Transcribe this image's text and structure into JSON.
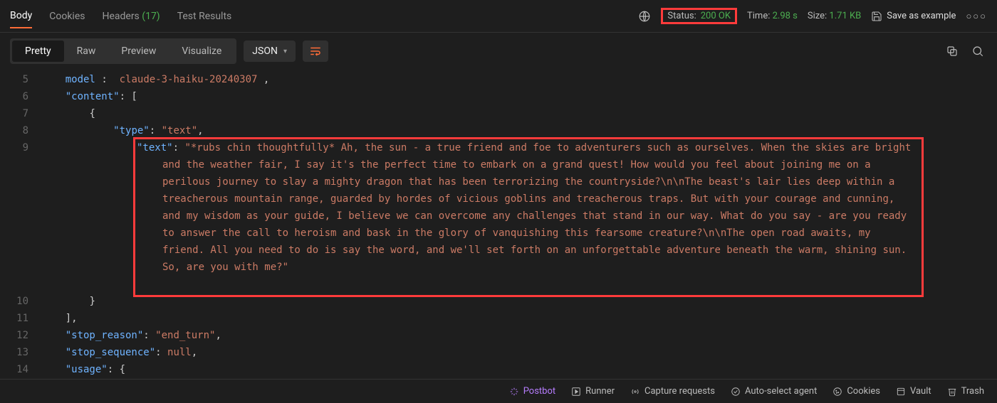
{
  "topTabs": {
    "body": "Body",
    "cookies": "Cookies",
    "headers": "Headers",
    "headersCount": "(17)",
    "testResults": "Test Results"
  },
  "status": {
    "label": "Status:",
    "value": "200 OK",
    "timeLabel": "Time:",
    "timeValue": "2.98 s",
    "sizeLabel": "Size:",
    "sizeValue": "1.71 KB",
    "saveExample": "Save as example"
  },
  "viewTabs": {
    "pretty": "Pretty",
    "raw": "Raw",
    "preview": "Preview",
    "visualize": "Visualize",
    "format": "JSON"
  },
  "response": {
    "line5_key": "model",
    "line5_val": "claude-3-haiku-20240307",
    "line6_key": "\"content\"",
    "line8_key": "\"type\"",
    "line8_val": "\"text\"",
    "line9_key": "\"text\"",
    "line9_val": "\"*rubs chin thoughtfully* Ah, the sun - a true friend and foe to adventurers such as ourselves. When the skies are bright and the weather fair, I say it's the perfect time to embark on a grand quest! How would you feel about joining me on a perilous journey to slay a mighty dragon that has been terrorizing the countryside?\\n\\nThe beast's lair lies deep within a treacherous mountain range, guarded by hordes of vicious goblins and treacherous traps. But with your courage and cunning, and my wisdom as your guide, I believe we can overcome any challenges that stand in our way. What do you say - are you ready to answer the call to heroism and bask in the glory of vanquishing this fearsome creature?\\n\\nThe open road awaits, my friend. All you need to do is say the word, and we'll set forth on an unforgettable adventure beneath the warm, shining sun. So, are you with me?\"",
    "line12_key": "\"stop_reason\"",
    "line12_val": "\"end_turn\"",
    "line13_key": "\"stop_sequence\"",
    "line13_val": "null",
    "line14_key": "\"usage\""
  },
  "lineNumbers": [
    "5",
    "6",
    "7",
    "8",
    "9",
    "10",
    "11",
    "12",
    "13",
    "14"
  ],
  "bottomBar": {
    "postbot": "Postbot",
    "runner": "Runner",
    "capture": "Capture requests",
    "autoSelect": "Auto-select agent",
    "cookies": "Cookies",
    "vault": "Vault",
    "trash": "Trash"
  }
}
